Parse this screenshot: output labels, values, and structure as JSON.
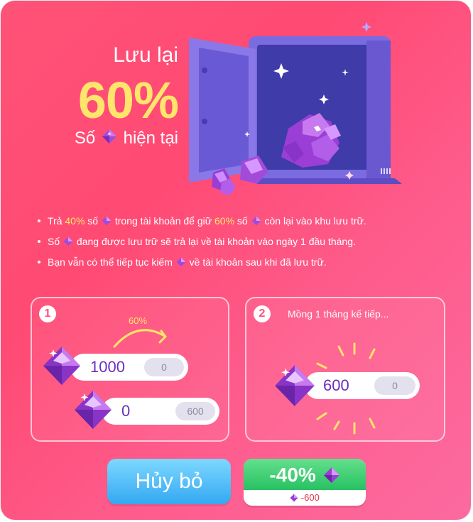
{
  "header": {
    "title": "Lưu lại",
    "percent": "60%",
    "subtitle_prefix": "Số",
    "subtitle_suffix": "hiện tại"
  },
  "bullets": [
    {
      "p1": "Trả ",
      "hl1": "40%",
      "p2": " số ",
      "p3": " trong tài khoản để giữ ",
      "hl2": "60%",
      "p4": " số ",
      "p5": " còn lại vào khu lưu trữ."
    },
    {
      "p1": "Số ",
      "p2": " đang được lưu trữ sẽ trả lại về tài khoản vào ngày 1 đầu tháng."
    },
    {
      "p1": "Bạn vẫn có thể tiếp tục kiếm ",
      "p2": " về tài khoản sau khi đã lưu trữ."
    }
  ],
  "step1": {
    "badge": "1",
    "arrow_label": "60%",
    "row1": {
      "value": "1000",
      "sub": "0"
    },
    "row2": {
      "value": "0",
      "sub": "600"
    }
  },
  "step2": {
    "badge": "2",
    "label": "Mồng 1 tháng kế tiếp...",
    "row": {
      "value": "600",
      "sub": "0"
    }
  },
  "buttons": {
    "cancel": "Hủy bỏ",
    "save_top": "-40%",
    "save_bottom": "-600"
  },
  "colors": {
    "gold": "#ffe56b",
    "purple": "#6a2fbd",
    "green": "#28c163",
    "blue": "#34a8f2",
    "red": "#e3324a"
  },
  "icons": [
    "gem-icon",
    "safe-icon",
    "sparkle-icon",
    "curved-arrow-icon"
  ]
}
